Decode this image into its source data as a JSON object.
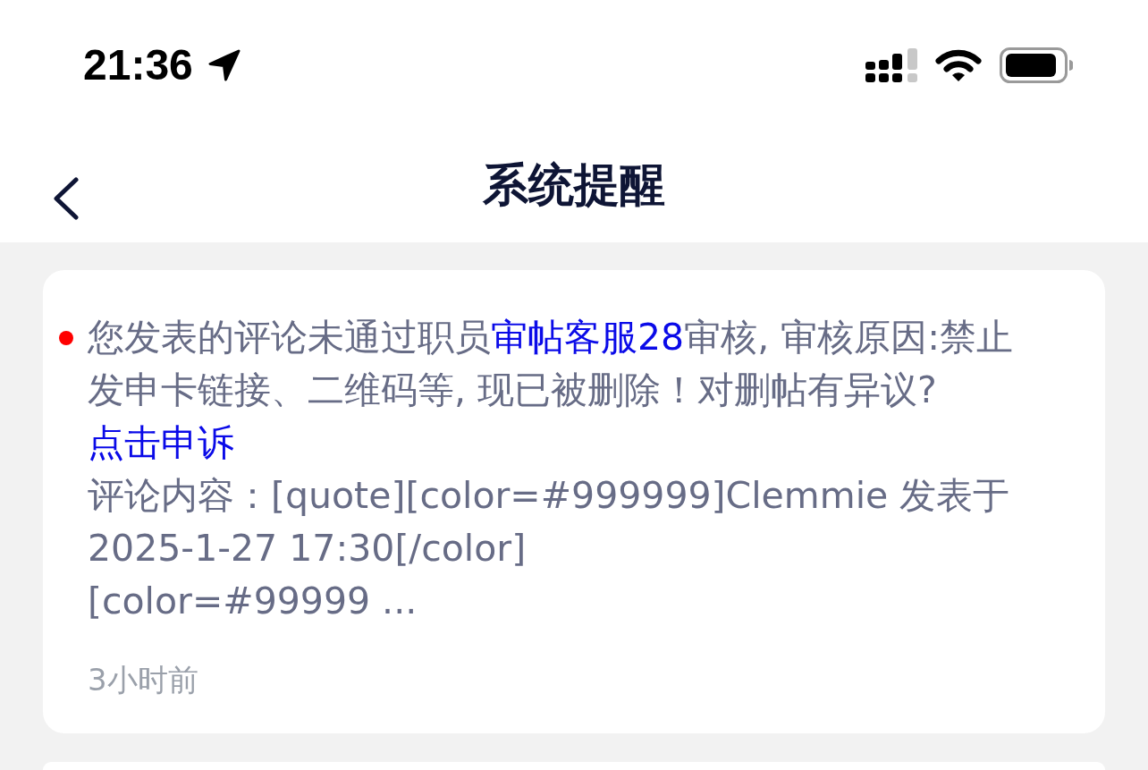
{
  "status_bar": {
    "time": "21:36"
  },
  "nav_bar": {
    "title": "系统提醒"
  },
  "messages": [
    {
      "unread": true,
      "text_parts": [
        {
          "kind": "text",
          "text": "您发表的评论未通过职员"
        },
        {
          "kind": "link",
          "text": "审帖客服28"
        },
        {
          "kind": "text",
          "text": "审核, 审核原因:禁止发申卡链接、二维码等, 现已被删除！对删帖有异议? "
        },
        {
          "kind": "link",
          "text": "点击申诉"
        }
      ],
      "comment": "评论内容：[quote][color=#999999]Clemmie 发表于 2025-1-27 17:30[/color]\n[color=#99999 ...",
      "time": "3小时前"
    }
  ]
}
